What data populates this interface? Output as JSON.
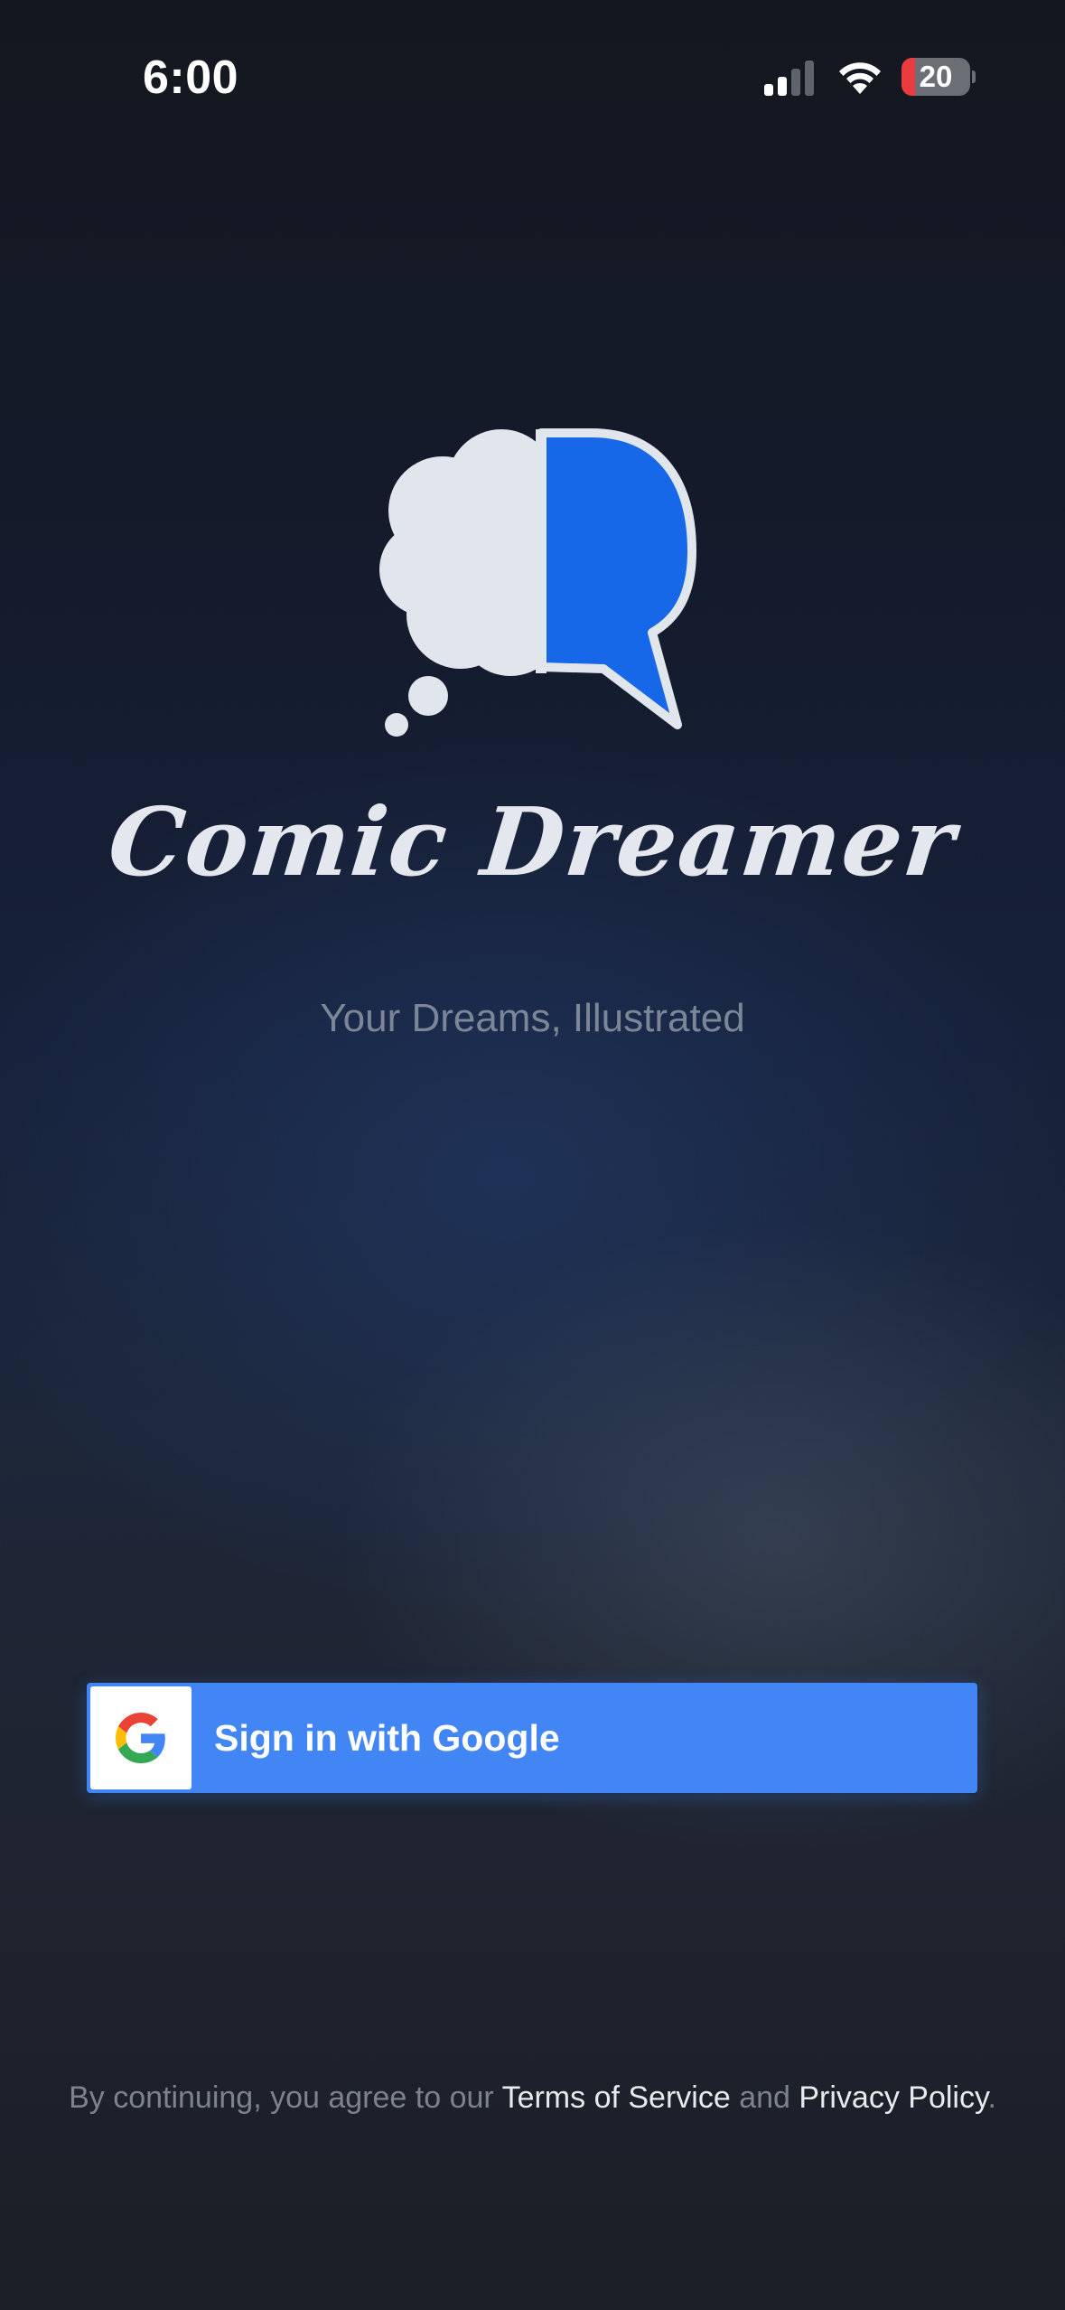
{
  "status_bar": {
    "time": "6:00",
    "battery_level": "20",
    "battery_fraction": 0.2,
    "signal_bars_active": 2,
    "signal_bars_total": 4,
    "icons": [
      "signal-icon",
      "wifi-icon",
      "battery-icon"
    ]
  },
  "brand": {
    "logo_icon": "thought-speech-bubble-icon",
    "app_name": "Comic Dreamer",
    "tagline": "Your Dreams, Illustrated"
  },
  "auth": {
    "google_button_label": "Sign in with Google",
    "google_icon": "google-g-icon"
  },
  "legal": {
    "prefix": "By continuing, you agree to our ",
    "terms_link": "Terms of Service",
    "middle": " and ",
    "privacy_link": "Privacy Policy",
    "suffix": "."
  },
  "colors": {
    "accent_blue": "#1668e8",
    "google_blue": "#4285f4",
    "bubble_light": "#e1e5ec",
    "battery_red": "#ea3b3f"
  }
}
